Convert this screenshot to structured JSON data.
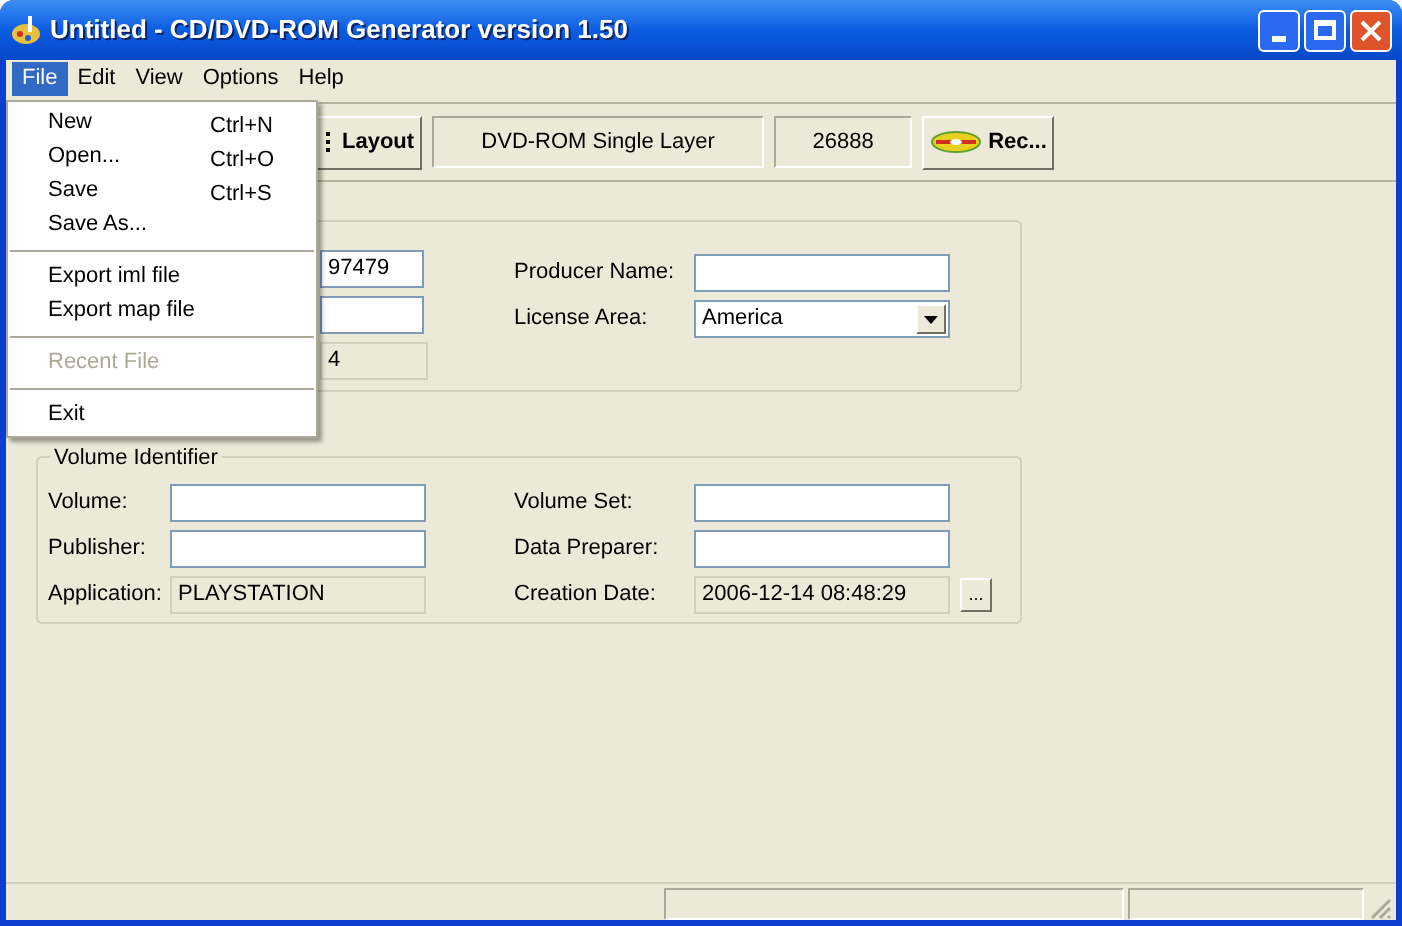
{
  "window": {
    "title": "Untitled - CD/DVD-ROM Generator version 1.50"
  },
  "menu_bar": [
    {
      "label": "File",
      "selected": true
    },
    {
      "label": "Edit",
      "selected": false
    },
    {
      "label": "View",
      "selected": false
    },
    {
      "label": "Options",
      "selected": false
    },
    {
      "label": "Help",
      "selected": false
    }
  ],
  "file_menu": [
    {
      "kind": "item",
      "label": "New",
      "shortcut": "Ctrl+N",
      "disabled": false
    },
    {
      "kind": "item",
      "label": "Open...",
      "shortcut": "Ctrl+O",
      "disabled": false
    },
    {
      "kind": "item",
      "label": "Save",
      "shortcut": "Ctrl+S",
      "disabled": false
    },
    {
      "kind": "item",
      "label": "Save As...",
      "disabled": false
    },
    {
      "kind": "separator"
    },
    {
      "kind": "item",
      "label": "Export iml file",
      "disabled": false
    },
    {
      "kind": "item",
      "label": "Export map file",
      "disabled": false
    },
    {
      "kind": "separator"
    },
    {
      "kind": "item",
      "label": "Recent File",
      "disabled": true
    },
    {
      "kind": "separator"
    },
    {
      "kind": "item",
      "label": "Exit",
      "disabled": false
    }
  ],
  "toolbar": {
    "layout_button": "Layout",
    "disc_type": "DVD-ROM Single Layer",
    "size": "26888",
    "record_button": "Rec..."
  },
  "disc_group": {
    "fields_left": [
      {
        "value": "97479",
        "readonly": false
      },
      {
        "readonly": false
      },
      {
        "value": "4",
        "readonly": true
      }
    ],
    "producer_name": {
      "label": "Producer Name:"
    },
    "license_area": {
      "label": "License Area:",
      "value": "America"
    }
  },
  "volume_group": {
    "title": "Volume Identifier",
    "left": [
      {
        "label": "Volume:",
        "readonly": false
      },
      {
        "label": "Publisher:",
        "readonly": false
      },
      {
        "label": "Application:",
        "value": "PLAYSTATION",
        "readonly": true
      }
    ],
    "right": [
      {
        "label": "Volume Set:",
        "readonly": false
      },
      {
        "label": "Data Preparer:",
        "readonly": false
      },
      {
        "label": "Creation Date:",
        "value": "2006-12-14 08:48:29",
        "readonly": true,
        "button": "..."
      }
    ]
  }
}
